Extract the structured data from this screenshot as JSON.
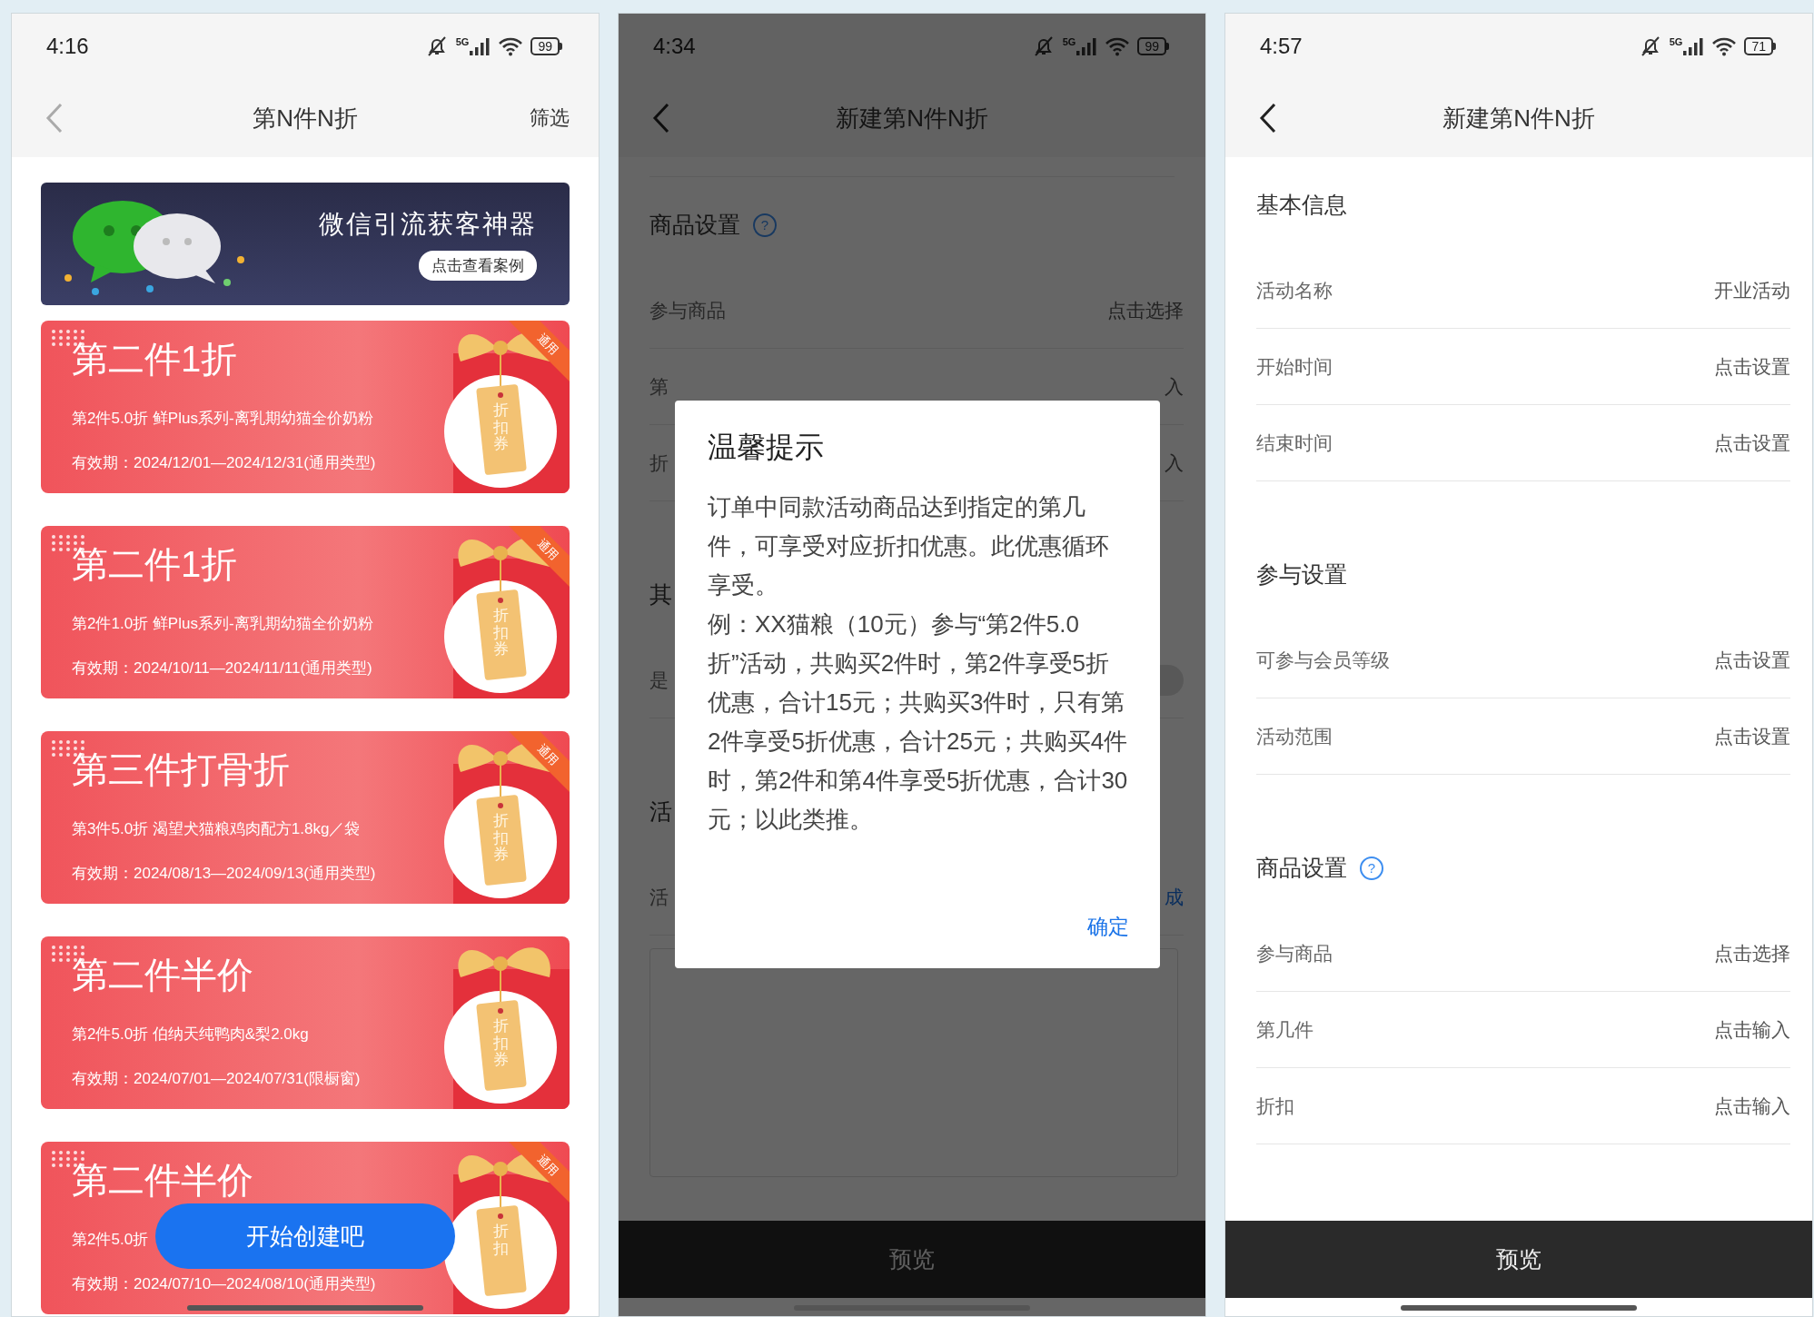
{
  "screens": [
    {
      "kind": "coupon_list",
      "status": {
        "time": "4:16",
        "network": "5G",
        "battery": "99"
      },
      "nav": {
        "title": "第N件N折",
        "action": "筛选"
      },
      "banner": {
        "headline": "微信引流获客神器",
        "button": "点击查看案例"
      },
      "cards": [
        {
          "title": "第二件1折",
          "detail": "第2件5.0折 鲜Plus系列-离乳期幼猫全价奶粉",
          "validity": "有效期：2024/12/01—2024/12/31(通用类型)",
          "tag": "折扣券",
          "corner": "通用"
        },
        {
          "title": "第二件1折",
          "detail": "第2件1.0折 鲜Plus系列-离乳期幼猫全价奶粉",
          "validity": "有效期：2024/10/11—2024/11/11(通用类型)",
          "tag": "折扣券",
          "corner": "通用"
        },
        {
          "title": "第三件打骨折",
          "detail": "第3件5.0折 渴望犬猫粮鸡肉配方1.8kg／袋",
          "validity": "有效期：2024/08/13—2024/09/13(通用类型)",
          "tag": "折扣券",
          "corner": "通用"
        },
        {
          "title": "第二件半价",
          "detail": "第2件5.0折 伯纳天纯鸭肉&梨2.0kg",
          "validity": "有效期：2024/07/01—2024/07/31(限橱窗)",
          "tag": "折扣券"
        },
        {
          "title": "第二件半价",
          "detail": "第2件5.0折",
          "validity": "有效期：2024/07/10—2024/08/10(通用类型)",
          "tag": "折扣",
          "corner": "通用"
        }
      ],
      "fab": "开始创建吧"
    },
    {
      "kind": "form_dialog",
      "status": {
        "time": "4:34",
        "network": "5G",
        "battery": "99"
      },
      "nav": {
        "title": "新建第N件N折"
      },
      "sections": [
        {
          "title": "商品设置",
          "help": "?",
          "rows": [
            {
              "kind": "value",
              "label": "参与商品",
              "value": "点击选择"
            },
            {
              "kind": "value",
              "label": "第",
              "value": "入"
            },
            {
              "kind": "value",
              "label": "折",
              "value": "入"
            }
          ]
        },
        {
          "title": "其",
          "rows": [
            {
              "kind": "toggle",
              "label": "是",
              "on": false
            }
          ]
        },
        {
          "title": "活",
          "rows": [
            {
              "kind": "link",
              "label": "活",
              "value": "成"
            },
            {
              "kind": "textarea"
            }
          ]
        }
      ],
      "bottom_button": "预览",
      "dialog": {
        "title": "温馨提示",
        "paragraphs": [
          "订单中同款活动商品达到指定的第几件，可享受对应折扣优惠。此优惠循环享受。",
          "例：XX猫粮（10元）参与“第2件5.0折”活动，共购买2件时，第2件享受5折优惠，合计15元；共购买3件时，只有第2件享受5折优惠，合计25元；共购买4件时，第2件和第4件享受5折优惠，合计30元；以此类推。"
        ],
        "confirm": "确定"
      }
    },
    {
      "kind": "form",
      "status": {
        "time": "4:57",
        "network": "5G",
        "battery": "71"
      },
      "nav": {
        "title": "新建第N件N折"
      },
      "sections": [
        {
          "title": "基本信息",
          "rows": [
            {
              "kind": "value",
              "label": "活动名称",
              "value": "开业活动"
            },
            {
              "kind": "value",
              "label": "开始时间",
              "value": "点击设置"
            },
            {
              "kind": "value",
              "label": "结束时间",
              "value": "点击设置"
            }
          ]
        },
        {
          "title": "参与设置",
          "rows": [
            {
              "kind": "value",
              "label": "可参与会员等级",
              "value": "点击设置"
            },
            {
              "kind": "value",
              "label": "活动范围",
              "value": "点击设置"
            }
          ]
        },
        {
          "title": "商品设置",
          "help": "?",
          "rows": [
            {
              "kind": "value",
              "label": "参与商品",
              "value": "点击选择"
            },
            {
              "kind": "value",
              "label": "第几件",
              "value": "点击输入"
            },
            {
              "kind": "value",
              "label": "折扣",
              "value": "点击输入"
            }
          ]
        }
      ],
      "bottom_button": "预览"
    }
  ]
}
